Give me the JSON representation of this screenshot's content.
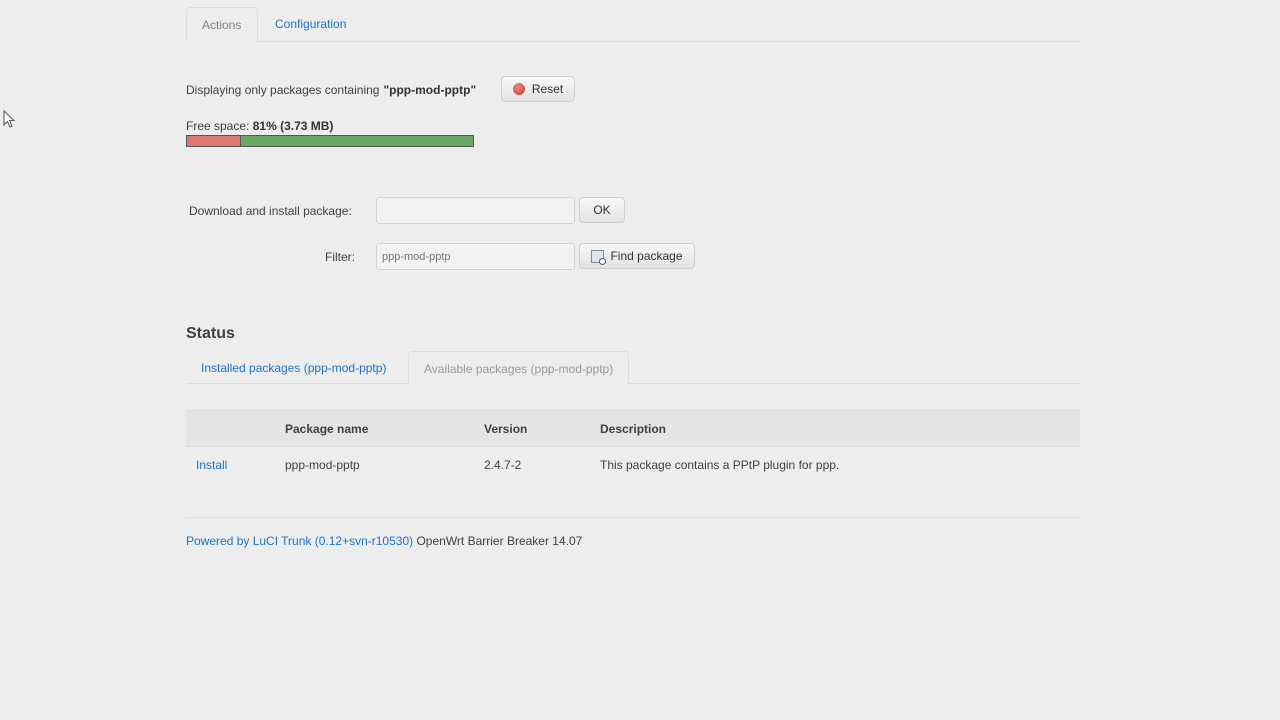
{
  "tabs": {
    "actions": "Actions",
    "configuration": "Configuration"
  },
  "filter_notice": {
    "prefix": "Displaying only packages containing",
    "term": "\"ppp-mod-pptp\"",
    "reset_label": "Reset"
  },
  "free_space": {
    "label": "Free space:",
    "value": "81% (3.73 MB)",
    "free_percent": 81
  },
  "download": {
    "label": "Download and install package:",
    "value": "",
    "ok_label": "OK"
  },
  "filter": {
    "label": "Filter:",
    "placeholder": "ppp-mod-pptp",
    "find_label": "Find package"
  },
  "status": {
    "heading": "Status",
    "tab_installed": "Installed packages (ppp-mod-pptp)",
    "tab_available": "Available packages (ppp-mod-pptp)"
  },
  "table": {
    "columns": [
      "",
      "Package name",
      "Version",
      "Description"
    ],
    "rows": [
      {
        "action": "Install",
        "name": "ppp-mod-pptp",
        "version": "2.4.7-2",
        "description": "This package contains a PPtP plugin for ppp."
      }
    ]
  },
  "footer": {
    "link": "Powered by LuCI Trunk (0.12+svn-r10530)",
    "text": "OpenWrt Barrier Breaker 14.07"
  },
  "colors": {
    "link": "#1a73c8",
    "bar_used": "#de7870",
    "bar_free": "#6aa964"
  }
}
